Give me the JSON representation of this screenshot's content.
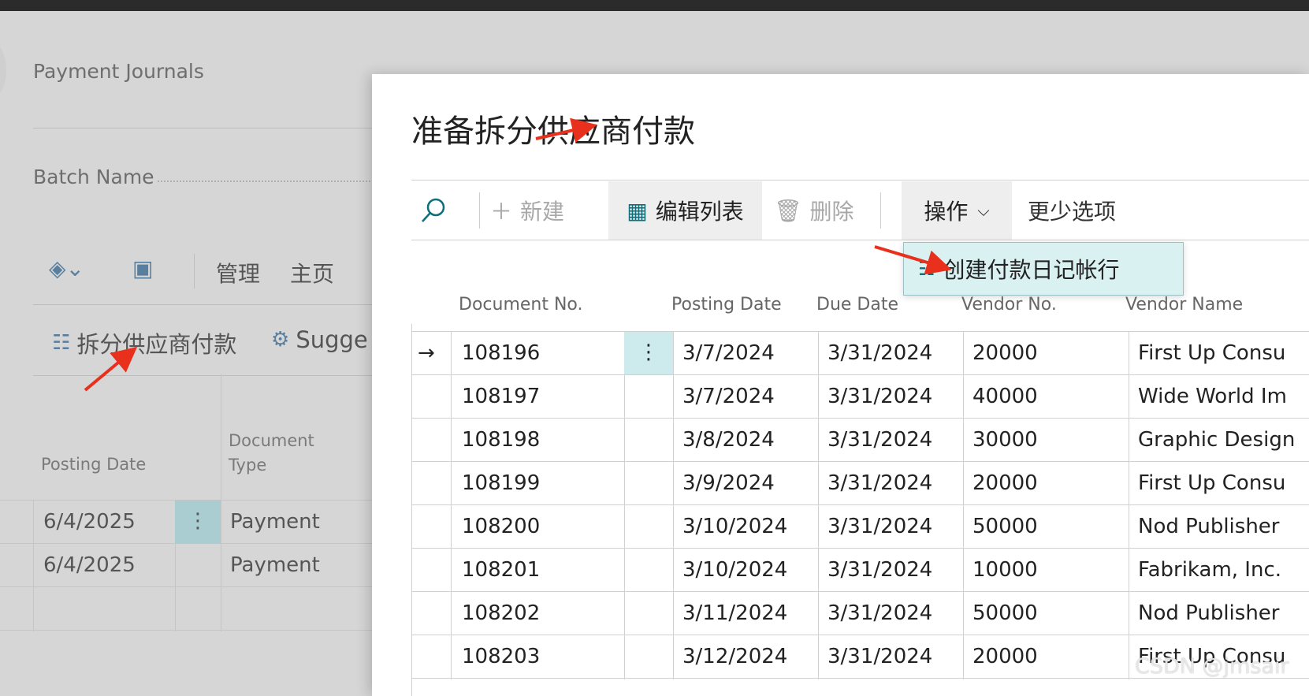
{
  "background": {
    "page_title": "Payment Journals",
    "batch_label": "Batch Name",
    "toolbar": {
      "manage": "管理",
      "home": "主页"
    },
    "actions": {
      "split": "拆分供应商付款",
      "suggest": "Sugge"
    },
    "columns": {
      "posting_date": "Posting Date",
      "document_type_1": "Document",
      "document_type_2": "Type"
    },
    "rows": [
      {
        "posting_date": "6/4/2025",
        "menu": "⋮",
        "document_type": "Payment"
      },
      {
        "posting_date": "6/4/2025",
        "menu": "",
        "document_type": "Payment"
      },
      {
        "posting_date": "",
        "menu": "",
        "document_type": ""
      }
    ]
  },
  "dialog": {
    "title": "准备拆分供应商付款",
    "toolbar": {
      "new": "新建",
      "edit_list": "编辑列表",
      "delete": "删除",
      "actions": "操作",
      "fewer_options": "更少选项"
    },
    "actions_menu": {
      "create_lines": "创建付款日记帐行"
    },
    "columns": {
      "document_no": "Document No.",
      "posting_date": "Posting Date",
      "due_date": "Due Date",
      "vendor_no": "Vendor No.",
      "vendor_name": "Vendor Name"
    },
    "rows": [
      {
        "indicator": "→",
        "menu": "⋮",
        "document_no": "108196",
        "posting_date": "3/7/2024",
        "due_date": "3/31/2024",
        "vendor_no": "20000",
        "vendor_name": "First Up Consu"
      },
      {
        "indicator": "",
        "menu": "",
        "document_no": "108197",
        "posting_date": "3/7/2024",
        "due_date": "3/31/2024",
        "vendor_no": "40000",
        "vendor_name": "Wide World Im"
      },
      {
        "indicator": "",
        "menu": "",
        "document_no": "108198",
        "posting_date": "3/8/2024",
        "due_date": "3/31/2024",
        "vendor_no": "30000",
        "vendor_name": "Graphic Design"
      },
      {
        "indicator": "",
        "menu": "",
        "document_no": "108199",
        "posting_date": "3/9/2024",
        "due_date": "3/31/2024",
        "vendor_no": "20000",
        "vendor_name": "First Up Consu"
      },
      {
        "indicator": "",
        "menu": "",
        "document_no": "108200",
        "posting_date": "3/10/2024",
        "due_date": "3/31/2024",
        "vendor_no": "50000",
        "vendor_name": "Nod Publisher"
      },
      {
        "indicator": "",
        "menu": "",
        "document_no": "108201",
        "posting_date": "3/10/2024",
        "due_date": "3/31/2024",
        "vendor_no": "10000",
        "vendor_name": "Fabrikam, Inc."
      },
      {
        "indicator": "",
        "menu": "",
        "document_no": "108202",
        "posting_date": "3/11/2024",
        "due_date": "3/31/2024",
        "vendor_no": "50000",
        "vendor_name": "Nod Publisher"
      },
      {
        "indicator": "",
        "menu": "",
        "document_no": "108203",
        "posting_date": "3/12/2024",
        "due_date": "3/31/2024",
        "vendor_no": "20000",
        "vendor_name": "First Up Consu"
      }
    ]
  },
  "watermark": "CSDN @jmsair",
  "colors": {
    "accent": "#0e6f7a",
    "selected_cell": "#cdebed",
    "menu_bg": "#daf1f2",
    "annotation": "#e8301c"
  }
}
